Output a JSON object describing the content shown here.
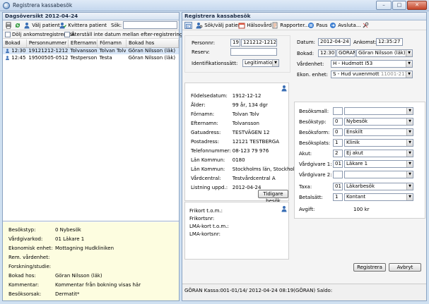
{
  "window": {
    "title": "Registrera kassabesök",
    "min": "–",
    "max": "□",
    "close": "✕"
  },
  "left": {
    "header": "Dagsöversikt  2012-04-24",
    "toolbar": {
      "valj": "Välj patient",
      "kvittera": "Kvittera patient",
      "sok_label": "Sök:",
      "sok_value": ""
    },
    "checks": {
      "dolj": "Dölj ankomstregistrerade",
      "aterstall": "Återställ inte datum mellan efter-registreringar"
    },
    "columns": [
      "Bokad",
      "Personnummer",
      "Efternamn",
      "Förnamn",
      "Bokad hos"
    ],
    "rows": [
      {
        "bokad": "12:30",
        "pnr": "19121212-1212",
        "efternamn": "Tolvansson",
        "fornamn": "Tolvan Tolv",
        "hos": "Göran Nilsson (läk)",
        "selected": true
      },
      {
        "bokad": "12:45",
        "pnr": "19500505-0512",
        "efternamn": "Testperson",
        "fornamn": "Testa",
        "hos": "Göran Nilsson (läk)",
        "selected": false
      }
    ],
    "details": [
      {
        "k": "Besökstyp:",
        "v": "0  Nybesök"
      },
      {
        "k": "Vårdgivarkod:",
        "v": "01 Läkare 1"
      },
      {
        "k": "Ekonomisk enhet:",
        "v": "Mottagning Hudkliniken"
      },
      {
        "k": "Rem. vårdenhet:",
        "v": ""
      },
      {
        "k": "Forskning/studie:",
        "v": ""
      },
      {
        "k": "Bokad hos:",
        "v": "Göran Nilsson (läk)"
      },
      {
        "k": "Kommentar:",
        "v": "Kommentar från bokning visas här"
      },
      {
        "k": "Besöksorsak:",
        "v": "Dermatit*"
      }
    ]
  },
  "right": {
    "header": "Registrera kassabesök",
    "toolbar": {
      "sok_valj": "Sök/välj patient",
      "halsovard": "Hälsovård",
      "rapporter": "Rapporter...",
      "paus": "Paus",
      "avsluta": "Avsluta..."
    },
    "patient": {
      "personnr_label": "Personnr:",
      "personnr_prefix": "19",
      "personnr_value": "121212-1212",
      "reserv_label": "Reserv:",
      "reserv_value": "",
      "idsatt_label": "Identifikationssätt:",
      "idsatt_value": "Legitimation"
    },
    "visit": {
      "datum_label": "Datum:",
      "datum_value": "2012-04-24",
      "ankomst_label": "Ankomst:",
      "ankomst_value": "12:35:27",
      "bokad_label": "Bokad:",
      "bokad_time": "12:30",
      "bokad_user": "GÖRAN",
      "bokad_name": "Göran Nilsson (läk)",
      "vardenhet_label": "Vårdenhet:",
      "vardenhet_value": "H - Hudmott I53",
      "ekon_label": "Ekon. enhet:",
      "ekon_value": "S - Hud vuxenmott",
      "ekon_code": "11001-211-M01"
    },
    "person": [
      {
        "k": "Födelsedatum:",
        "v": "1912-12-12"
      },
      {
        "k": "Ålder:",
        "v": "99 år, 134 dgr"
      },
      {
        "k": "Förnamn:",
        "v": "Tolvan Tolv"
      },
      {
        "k": "Efternamn:",
        "v": "Tolvansson"
      },
      {
        "k": "Gatuadress:",
        "v": "TESTVÄGEN 12"
      },
      {
        "k": "Postadress:",
        "v": "12121      TESTBERGA"
      },
      {
        "k": "Telefonnummer:",
        "v": "08-123 79 976"
      },
      {
        "k": "Län Kommun:",
        "v": "0180"
      },
      {
        "k": "Län Kommun:",
        "v": "Stockholms län, Stockholm"
      },
      {
        "k": "Vårdcentral:",
        "v": "Testvårdcentral A"
      },
      {
        "k": "Listning uppd.:",
        "v": "2012-04-24"
      }
    ],
    "tidigare_button": "Tidigare besök",
    "frikort": [
      {
        "k": "Frikort t.o.m.:"
      },
      {
        "k": "Frikortsnr:"
      },
      {
        "k": "LMA-kort t.o.m.:"
      },
      {
        "k": "LMA-kortsnr:"
      }
    ],
    "form": [
      {
        "k": "Besöksmall:",
        "code": "",
        "value": ""
      },
      {
        "k": "Besökstyp:",
        "code": "0",
        "value": "Nybesök"
      },
      {
        "k": "Besöksform:",
        "code": "0",
        "value": "Enskilt"
      },
      {
        "k": "Besöksplats:",
        "code": "1",
        "value": "Klinik"
      },
      {
        "k": "Akut:",
        "code": "2",
        "value": "Ej akut"
      },
      {
        "k": "Vårdgivare 1:",
        "code": "01",
        "value": "Läkare 1"
      },
      {
        "k": "Vårdgivare 2:",
        "code": "",
        "value": ""
      },
      {
        "k": "Taxa:",
        "code": "01",
        "value": "Läkarbesök"
      },
      {
        "k": "Betalsätt:",
        "code": "1",
        "value": "Kontant"
      }
    ],
    "avgift_label": "Avgift:",
    "avgift_value": "100 kr",
    "registrera": "Registrera",
    "avbryt": "Avbryt",
    "status": "GÖRAN  Kassa:001-01/14/  2012-04-24 08:19(GÖRAN)  Saldo:"
  }
}
